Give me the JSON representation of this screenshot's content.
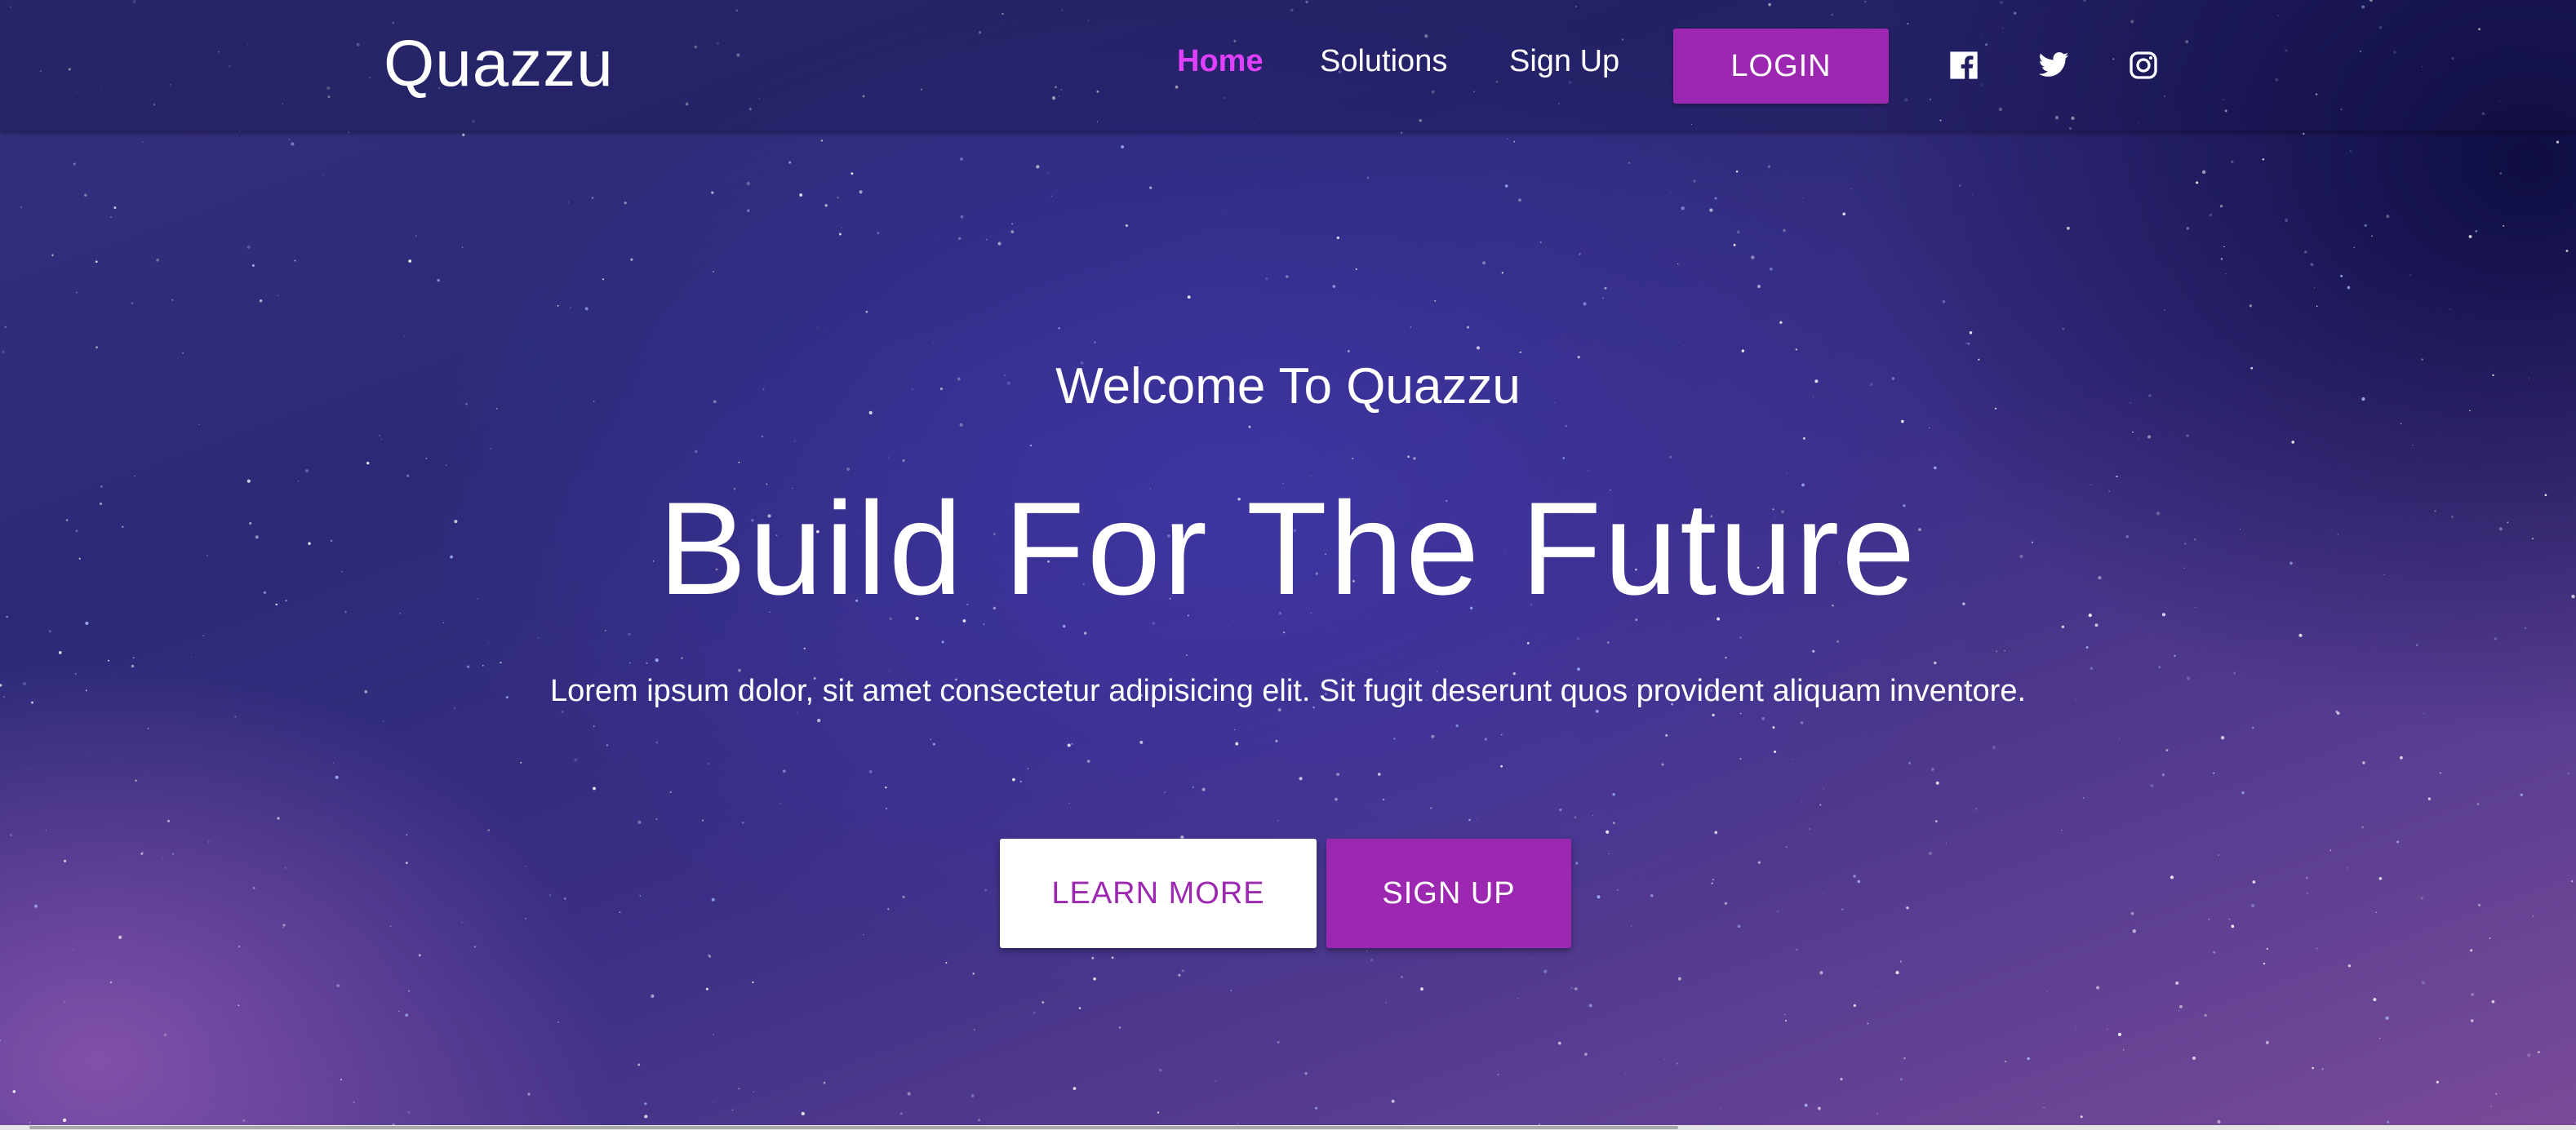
{
  "brand": {
    "name": "Quazzu"
  },
  "nav": {
    "links": [
      {
        "label": "Home",
        "active": true
      },
      {
        "label": "Solutions",
        "active": false
      },
      {
        "label": "Sign Up",
        "active": false
      }
    ],
    "login_label": "LOGIN",
    "social": [
      "facebook-icon",
      "twitter-icon",
      "instagram-icon"
    ]
  },
  "hero": {
    "welcome": "Welcome To Quazzu",
    "headline": "Build For The Future",
    "subtext": "Lorem ipsum dolor, sit amet consectetur adipisicing elit. Sit fugit deserunt quos provident aliquam inventore.",
    "learn_more_label": "LEARN MORE",
    "sign_up_label": "SIGN UP"
  },
  "colors": {
    "accent": "#9c27b0",
    "active_link": "#e040fb",
    "text": "#ffffff"
  }
}
